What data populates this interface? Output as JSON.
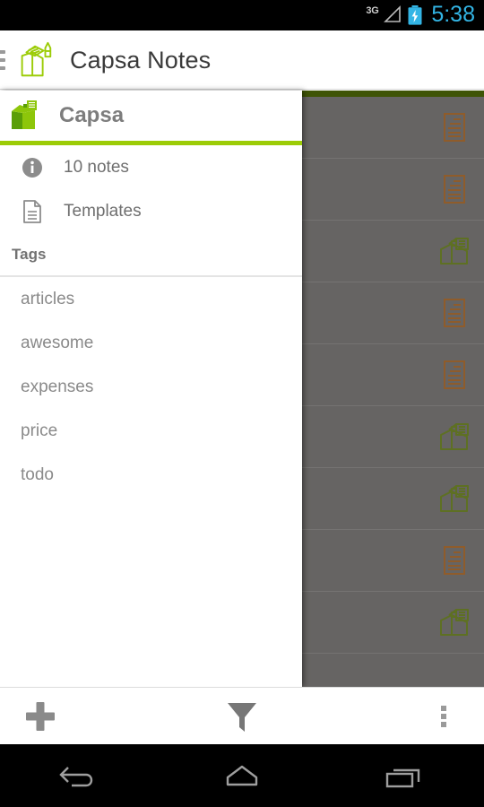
{
  "statusbar": {
    "network_label": "3G",
    "time": "5:38",
    "time_color": "#33b5e5",
    "battery_state": "charging",
    "icons": [
      "signal-triangle-icon",
      "battery-charging-icon"
    ]
  },
  "actionbar": {
    "menu_icon": "hamburger-menu-icon",
    "logo_icon": "capsa-logo-icon",
    "title": "Capsa Notes",
    "accent_color": "#9ccc07"
  },
  "drawer": {
    "header": {
      "logo_icon": "capsa-logo-icon",
      "title": "Capsa"
    },
    "items": [
      {
        "label": "10 notes",
        "icon": "info-icon"
      },
      {
        "label": "Templates",
        "icon": "document-icon"
      }
    ],
    "tags_header": "Tags",
    "tags": [
      {
        "label": "articles"
      },
      {
        "label": "awesome"
      },
      {
        "label": "expenses"
      },
      {
        "label": "price"
      },
      {
        "label": "todo"
      }
    ]
  },
  "content": {
    "scrim_color": "#666463",
    "note_icon_color": "#8f5c2b",
    "capsa_icon_color": "#5e7023",
    "rows": [
      {
        "icon": "note-icon"
      },
      {
        "icon": "note-icon"
      },
      {
        "icon": "capsa-icon"
      },
      {
        "icon": "note-icon"
      },
      {
        "icon": "note-icon"
      },
      {
        "icon": "capsa-icon"
      },
      {
        "icon": "capsa-icon"
      },
      {
        "icon": "note-icon"
      },
      {
        "icon": "capsa-icon"
      }
    ]
  },
  "bottombar": {
    "buttons": [
      {
        "name": "add-note-button",
        "icon": "plus-icon"
      },
      {
        "name": "filter-button",
        "icon": "funnel-icon"
      },
      {
        "name": "overflow-menu-button",
        "icon": "more-vertical-icon"
      }
    ]
  },
  "navbar": {
    "buttons": [
      {
        "name": "back-button",
        "icon": "back-arrow-icon"
      },
      {
        "name": "home-button",
        "icon": "home-icon"
      },
      {
        "name": "recents-button",
        "icon": "recents-icon"
      }
    ]
  }
}
